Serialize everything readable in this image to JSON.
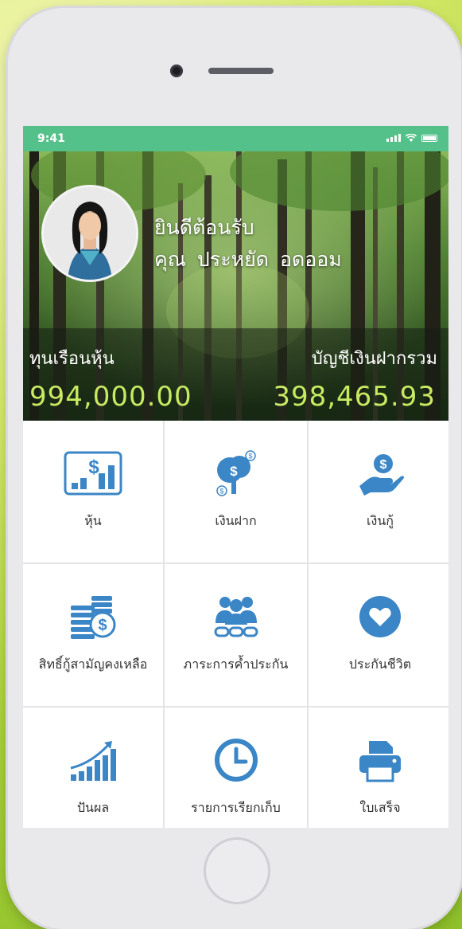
{
  "status_bar": {
    "time": "9:41"
  },
  "header": {
    "welcome_line1": "ยินดีต้อนรับ",
    "name_prefix": "คุณ",
    "first_name": "ประหยัด",
    "last_name": "อดออม"
  },
  "summary": {
    "shares_label": "ทุนเรือนหุ้น",
    "shares_value": "994,000.00",
    "deposits_label": "บัญชีเงินฝากรวม",
    "deposits_value": "398,465.93"
  },
  "menu": [
    {
      "label": "หุ้น",
      "icon": "shares-chart-icon"
    },
    {
      "label": "เงินฝาก",
      "icon": "money-tree-icon"
    },
    {
      "label": "เงินกู้",
      "icon": "hand-coin-icon"
    },
    {
      "label": "สิทธิ์กู้สามัญคงเหลือ",
      "icon": "coin-stack-icon"
    },
    {
      "label": "ภาระการค้ำประกัน",
      "icon": "guarantors-icon"
    },
    {
      "label": "ประกันชีวิต",
      "icon": "heart-icon"
    },
    {
      "label": "ปันผล",
      "icon": "dividend-growth-icon"
    },
    {
      "label": "รายการเรียกเก็บ",
      "icon": "clock-icon"
    },
    {
      "label": "ใบเสร็จ",
      "icon": "printer-icon"
    }
  ],
  "colors": {
    "status_bar": "#55c18a",
    "icon_blue": "#3b86c6",
    "value_green": "#c8ea62"
  }
}
